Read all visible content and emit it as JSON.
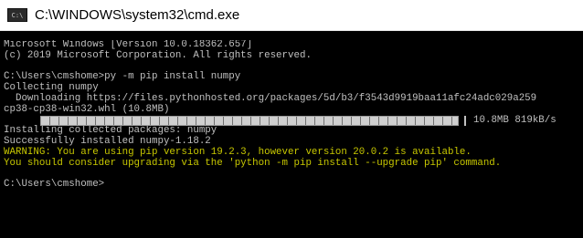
{
  "window": {
    "title": "C:\\WINDOWS\\system32\\cmd.exe",
    "icon": "cmd-console-icon",
    "icon_text": "C:\\"
  },
  "console": {
    "header_1": "Microsoft Windows [Version 10.0.18362.657]",
    "header_2": "(c) 2019 Microsoft Corporation. All rights reserved.",
    "command": "C:\\Users\\cmshome>py -m pip install numpy",
    "collecting": "Collecting numpy",
    "downloading": "  Downloading https://files.pythonhosted.org/packages/5d/b3/f3543d9919baa11afc24adc029a259",
    "wheel": "cp38-cp38-win32.whl (10.8MB)",
    "progress": {
      "fraction": 1.0,
      "size": "10.8MB",
      "speed": "819kB/s"
    },
    "installing": "Installing collected packages: numpy",
    "installed": "Successfully installed numpy-1.18.2",
    "warning_1": "WARNING: You are using pip version 19.2.3, however version 20.0.2 is available.",
    "warning_2": "You should consider upgrading via the 'python -m pip install --upgrade pip' command.",
    "prompt": "C:\\Users\\cmshome>"
  },
  "colors": {
    "console_bg": "#000000",
    "console_text": "#c0c0c0",
    "warning_text": "#c8c800"
  }
}
